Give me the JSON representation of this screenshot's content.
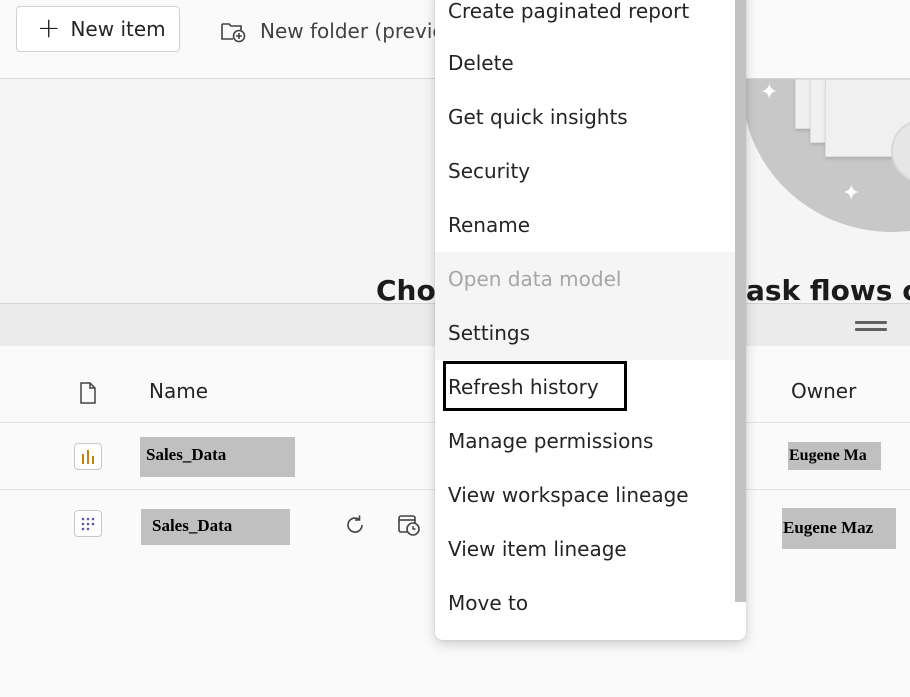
{
  "toolbar": {
    "new_item_label": "New item",
    "new_folder_label": "New folder (preview)"
  },
  "hero": {
    "title_left": "Choo",
    "title_right": "ask flows or"
  },
  "table": {
    "headers": {
      "name": "Name",
      "owner": "Owner"
    },
    "rows": [
      {
        "name": "Sales_Data",
        "owner": "Eugene Ma",
        "type_icon": "report-icon",
        "type_color": "#c77f1a"
      },
      {
        "name": "Sales_Data",
        "owner": "Eugene Maz",
        "type_icon": "semantic-model-icon",
        "type_color": "#5c5aa8"
      }
    ]
  },
  "context_menu": {
    "items": [
      {
        "label": "Create paginated report",
        "state": "normal"
      },
      {
        "label": "Delete",
        "state": "normal"
      },
      {
        "label": "Get quick insights",
        "state": "normal"
      },
      {
        "label": "Security",
        "state": "normal"
      },
      {
        "label": "Rename",
        "state": "normal"
      },
      {
        "label": "Open data model",
        "state": "disabled"
      },
      {
        "label": "Settings",
        "state": "hovered"
      },
      {
        "label": "Refresh history",
        "state": "highlighted"
      },
      {
        "label": "Manage permissions",
        "state": "normal"
      },
      {
        "label": "View workspace lineage",
        "state": "normal"
      },
      {
        "label": "View item lineage",
        "state": "normal"
      },
      {
        "label": "Move to",
        "state": "normal"
      }
    ]
  },
  "colors": {
    "accent_highlight": "#000000",
    "redaction": "#c0c0c0",
    "hero_graphic": "#c8c8c8"
  }
}
